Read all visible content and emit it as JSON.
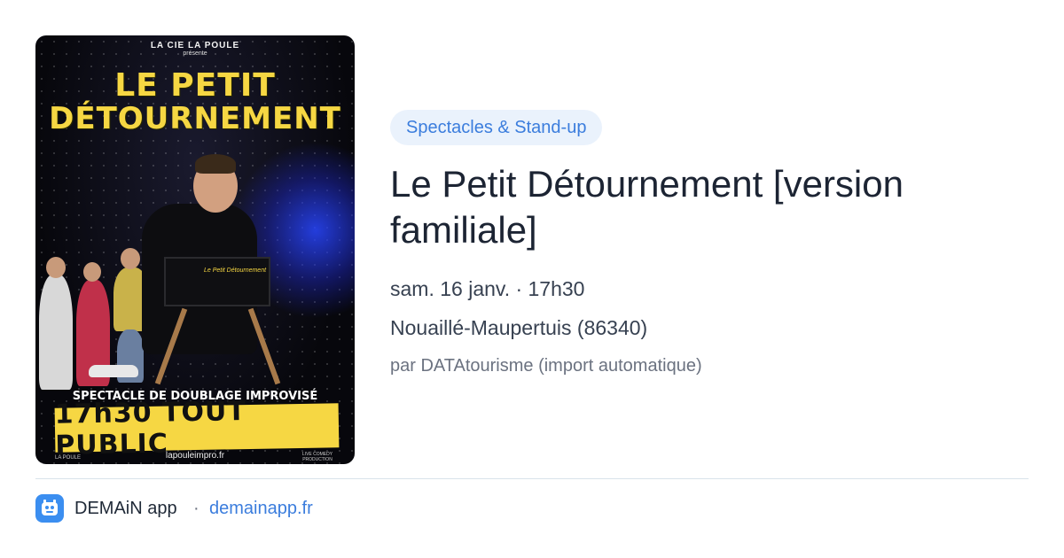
{
  "poster": {
    "presenter": "LA CIE LA POULE",
    "presente": "présente",
    "title_line1": "LE PETIT",
    "title_line2": "DÉTOURNEMENT",
    "chair_text": "Le Petit Détournement",
    "subtitle": "SPECTACLE DE DOUBLAGE IMPROVISÉ",
    "banner": "17h30 TOUT PUBLIC",
    "url": "lapouleimpro.fr",
    "logo_left": "LA POULE",
    "logo_right": "LIVE COMEDY PRODUCTION"
  },
  "event": {
    "category": "Spectacles & Stand-up",
    "title": "Le Petit Détournement [version familiale]",
    "datetime": "sam. 16 janv. · 17h30",
    "location": "Nouaillé-Maupertuis (86340)",
    "source": "par DATAtourisme (import automatique)"
  },
  "footer": {
    "app_name": "DEMAiN app",
    "separator": "·",
    "app_url": "demainapp.fr"
  },
  "colors": {
    "accent": "#3b7ddd",
    "category_bg": "#eaf2fc",
    "poster_yellow": "#f6d743"
  }
}
